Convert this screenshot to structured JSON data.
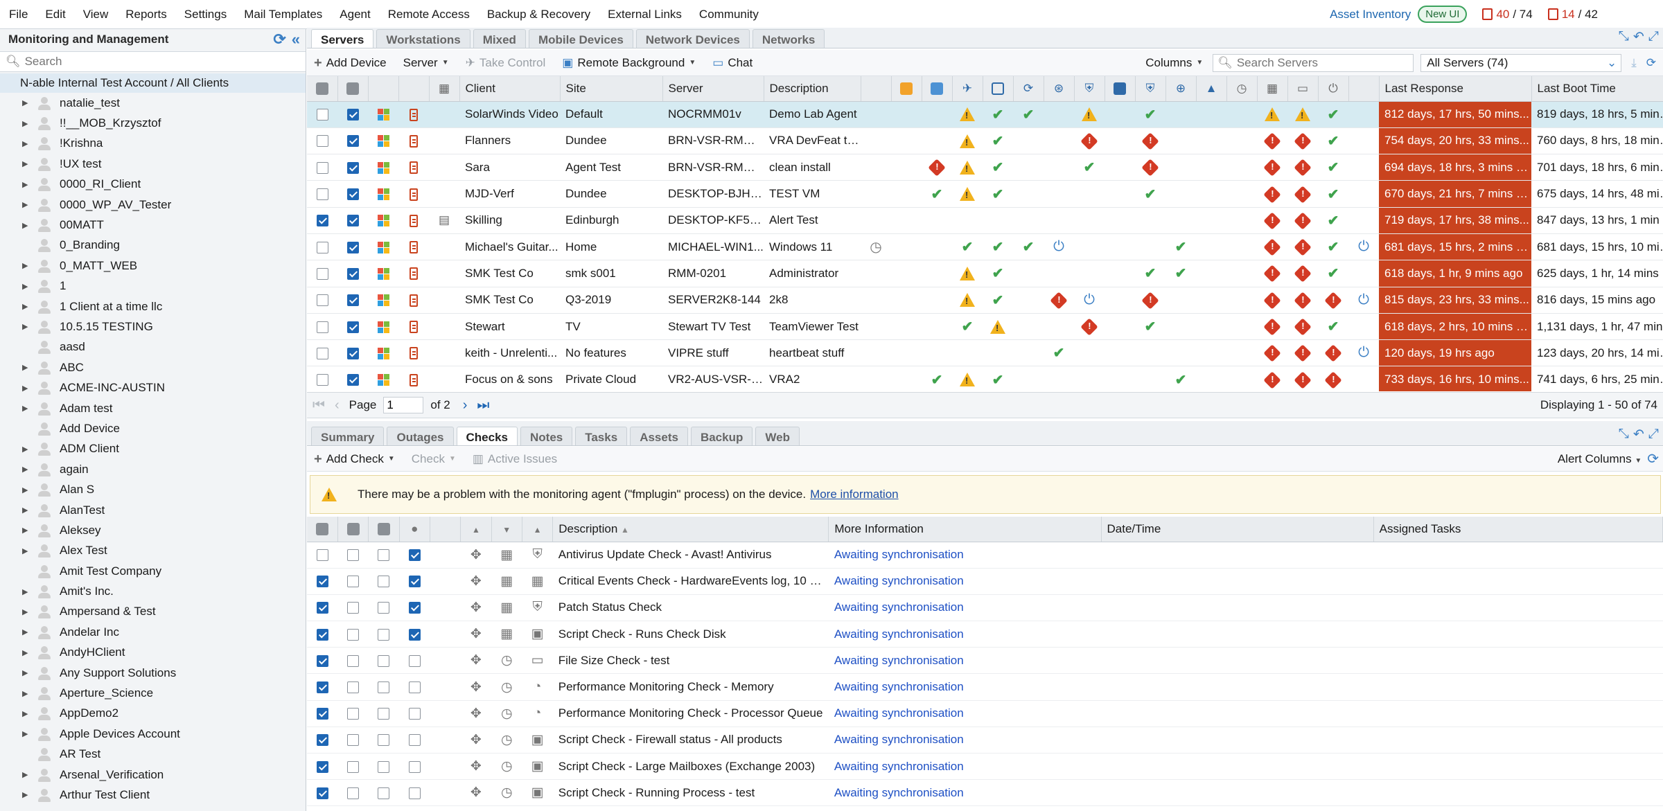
{
  "menu": {
    "items": [
      "File",
      "Edit",
      "View",
      "Reports",
      "Settings",
      "Mail Templates",
      "Agent",
      "Remote Access",
      "Backup & Recovery",
      "External Links",
      "Community"
    ],
    "asset_inventory": "Asset Inventory",
    "new_ui": "New UI",
    "counter1_value": "40",
    "counter1_total": "/ 74",
    "counter2_value": "14",
    "counter2_total": "/ 42"
  },
  "sidebar": {
    "title": "Monitoring and Management",
    "search_placeholder": "Search",
    "root": "N-able Internal Test Account / All Clients",
    "clients": [
      {
        "name": "natalie_test",
        "expandable": true
      },
      {
        "name": "!!__MOB_Krzysztof",
        "expandable": true
      },
      {
        "name": "!Krishna",
        "expandable": true
      },
      {
        "name": "!UX test",
        "expandable": true
      },
      {
        "name": "0000_RI_Client",
        "expandable": true
      },
      {
        "name": "0000_WP_AV_Tester",
        "expandable": true
      },
      {
        "name": "00MATT",
        "expandable": true
      },
      {
        "name": "0_Branding",
        "expandable": false
      },
      {
        "name": "0_MATT_WEB",
        "expandable": true
      },
      {
        "name": "1",
        "expandable": true
      },
      {
        "name": "1 Client at a time llc",
        "expandable": true
      },
      {
        "name": "10.5.15 TESTING",
        "expandable": true
      },
      {
        "name": "aasd",
        "expandable": false
      },
      {
        "name": "ABC",
        "expandable": true
      },
      {
        "name": "ACME-INC-AUSTIN",
        "expandable": true
      },
      {
        "name": "Adam test",
        "expandable": true
      },
      {
        "name": "Add Device",
        "expandable": false
      },
      {
        "name": "ADM Client",
        "expandable": true
      },
      {
        "name": "again",
        "expandable": true
      },
      {
        "name": "Alan S",
        "expandable": true
      },
      {
        "name": "AlanTest",
        "expandable": true
      },
      {
        "name": "Aleksey",
        "expandable": true
      },
      {
        "name": "Alex Test",
        "expandable": true
      },
      {
        "name": "Amit Test Company",
        "expandable": false
      },
      {
        "name": "Amit's Inc.",
        "expandable": true
      },
      {
        "name": "Ampersand & Test",
        "expandable": true
      },
      {
        "name": "Andelar Inc",
        "expandable": true
      },
      {
        "name": "AndyHClient",
        "expandable": true
      },
      {
        "name": "Any Support Solutions",
        "expandable": true
      },
      {
        "name": "Aperture_Science",
        "expandable": true
      },
      {
        "name": "AppDemo2",
        "expandable": true
      },
      {
        "name": "Apple Devices Account",
        "expandable": true
      },
      {
        "name": "AR Test",
        "expandable": false
      },
      {
        "name": "Arsenal_Verification",
        "expandable": true
      },
      {
        "name": "Arthur Test Client",
        "expandable": true
      }
    ]
  },
  "top_tabs": [
    "Servers",
    "Workstations",
    "Mixed",
    "Mobile Devices",
    "Network Devices",
    "Networks"
  ],
  "servers_toolbar": {
    "add_device": "Add Device",
    "server": "Server",
    "take_control": "Take Control",
    "remote_background": "Remote Background",
    "chat": "Chat",
    "columns": "Columns",
    "search_placeholder": "Search Servers",
    "filter": "All Servers (74)"
  },
  "servers_columns": {
    "client": "Client",
    "site": "Site",
    "server": "Server",
    "description": "Description",
    "last_response": "Last Response",
    "last_boot": "Last Boot Time"
  },
  "status_icon_colors": {
    "ok": "#3fa34d",
    "warn": "#f1b21d",
    "err": "#d33a24",
    "response_bg": "#c9431e"
  },
  "servers": [
    {
      "sel": false,
      "on": true,
      "note": false,
      "client": "SolarWinds Video",
      "site": "Default",
      "server": "NOCRMM01v",
      "desc": "Demo Lab Agent",
      "st": [
        "",
        "",
        "",
        "warn",
        "ok",
        "ok",
        "",
        "warn",
        "",
        "ok",
        "",
        "",
        "",
        "warn",
        "warn",
        "ok",
        ""
      ],
      "resp": "812 days, 17 hrs, 50 mins...",
      "boot": "819 days, 18 hrs, 5 mins a...",
      "highlight": true
    },
    {
      "sel": false,
      "on": true,
      "note": false,
      "client": "Flanners",
      "site": "Dundee",
      "server": "BRN-VSR-RMM-...",
      "desc": "VRA DevFeat te...",
      "st": [
        "",
        "",
        "",
        "warn",
        "ok",
        "",
        "",
        "err",
        "",
        "err",
        "",
        "",
        "",
        "err",
        "err",
        "ok",
        ""
      ],
      "resp": "754 days, 20 hrs, 33 mins...",
      "boot": "760 days, 8 hrs, 18 mins a..."
    },
    {
      "sel": false,
      "on": true,
      "note": false,
      "client": "Sara",
      "site": "Agent Test",
      "server": "BRN-VSR-RMM-...",
      "desc": "clean install",
      "st": [
        "",
        "",
        "err",
        "warn",
        "ok",
        "",
        "",
        "ok",
        "",
        "err",
        "",
        "",
        "",
        "err",
        "err",
        "ok",
        ""
      ],
      "resp": "694 days, 18 hrs, 3 mins a...",
      "boot": "701 days, 18 hrs, 6 mins a..."
    },
    {
      "sel": false,
      "on": true,
      "note": false,
      "client": "MJD-Verf",
      "site": "Dundee",
      "server": "DESKTOP-BJHR...",
      "desc": "TEST VM",
      "st": [
        "",
        "",
        "ok",
        "warn",
        "ok",
        "",
        "",
        "",
        "",
        "ok",
        "",
        "",
        "",
        "err",
        "err",
        "ok",
        ""
      ],
      "resp": "670 days, 21 hrs, 7 mins a...",
      "boot": "675 days, 14 hrs, 48 mins..."
    },
    {
      "sel": true,
      "on": true,
      "note": true,
      "client": "Skilling",
      "site": "Edinburgh",
      "server": "DESKTOP-KF5N...",
      "desc": "Alert Test",
      "st": [
        "",
        "",
        "",
        "",
        "",
        "",
        "",
        "",
        "",
        "",
        "",
        "",
        "",
        "err",
        "err",
        "ok",
        ""
      ],
      "resp": "719 days, 17 hrs, 38 mins...",
      "boot": "847 days, 13 hrs, 1 min ago"
    },
    {
      "sel": false,
      "on": true,
      "note": false,
      "client": "Michael's Guitar...",
      "site": "Home",
      "server": "MICHAEL-WIN1...",
      "desc": "Windows 11",
      "st": [
        "clock",
        "",
        "",
        "ok",
        "ok",
        "ok",
        "pow",
        "",
        "",
        "",
        "ok",
        "",
        "",
        "err",
        "err",
        "ok",
        "pow"
      ],
      "resp": "681 days, 15 hrs, 2 mins a...",
      "boot": "681 days, 15 hrs, 10 mins..."
    },
    {
      "sel": false,
      "on": true,
      "note": false,
      "client": "SMK Test Co",
      "site": "smk s001",
      "server": "RMM-0201",
      "desc": "Administrator",
      "st": [
        "",
        "",
        "",
        "warn",
        "ok",
        "",
        "",
        "",
        "",
        "ok",
        "ok",
        "",
        "",
        "err",
        "err",
        "ok",
        ""
      ],
      "resp": "618 days, 1 hr, 9 mins ago",
      "boot": "625 days, 1 hr, 14 mins ago"
    },
    {
      "sel": false,
      "on": true,
      "note": false,
      "client": "SMK Test Co",
      "site": "Q3-2019",
      "server": "SERVER2K8-144",
      "desc": "2k8",
      "st": [
        "",
        "",
        "",
        "warn",
        "ok",
        "",
        "err",
        "pow",
        "",
        "err",
        "",
        "",
        "",
        "err",
        "err",
        "err",
        "pow"
      ],
      "resp": "815 days, 23 hrs, 33 mins...",
      "boot": "816 days, 15 mins ago"
    },
    {
      "sel": false,
      "on": true,
      "note": false,
      "client": "Stewart",
      "site": "TV",
      "server": "Stewart TV Test",
      "desc": "TeamViewer Test",
      "st": [
        "",
        "",
        "",
        "ok",
        "warn",
        "",
        "",
        "err",
        "",
        "ok",
        "",
        "",
        "",
        "err",
        "err",
        "ok",
        ""
      ],
      "resp": "618 days, 2 hrs, 10 mins a...",
      "boot": "1,131 days, 1 hr, 47 mins ..."
    },
    {
      "sel": false,
      "on": true,
      "note": false,
      "client": "keith - Unrelenti...",
      "site": "No features",
      "server": "VIPRE stuff",
      "desc": "heartbeat stuff",
      "st": [
        "",
        "",
        "",
        "",
        "",
        "",
        "ok",
        "",
        "",
        "",
        "",
        "",
        "",
        "err",
        "err",
        "err",
        "pow"
      ],
      "resp": "120 days, 19 hrs ago",
      "boot": "123 days, 20 hrs, 14 mins..."
    },
    {
      "sel": false,
      "on": true,
      "note": false,
      "client": "Focus on & sons",
      "site": "Private Cloud",
      "server": "VR2-AUS-VSR-P...",
      "desc": "VRA2",
      "st": [
        "",
        "",
        "ok",
        "warn",
        "ok",
        "",
        "",
        "",
        "",
        "",
        "ok",
        "",
        "",
        "err",
        "err",
        "err",
        ""
      ],
      "resp": "733 days, 16 hrs, 10 mins...",
      "boot": "741 days, 6 hrs, 25 mins a..."
    }
  ],
  "pager": {
    "page_label": "Page",
    "page_value": "1",
    "of": "of 2",
    "displaying": "Displaying 1 - 50 of 74"
  },
  "bottom_tabs": [
    "Summary",
    "Outages",
    "Checks",
    "Notes",
    "Tasks",
    "Assets",
    "Backup",
    "Web"
  ],
  "checks_toolbar": {
    "add_check": "Add Check",
    "check": "Check",
    "active_issues": "Active Issues",
    "alert_columns": "Alert Columns"
  },
  "banner": {
    "text": "There may be a problem with the monitoring agent (\"fmplugin\" process) on the device.",
    "link": "More information"
  },
  "checks_columns": {
    "description": "Description",
    "more_info": "More Information",
    "datetime": "Date/Time",
    "assigned_tasks": "Assigned Tasks"
  },
  "checks": [
    {
      "c1": false,
      "c2": false,
      "c3": false,
      "c4": true,
      "type": "shield",
      "desc": "Antivirus Update Check - Avast! Antivirus",
      "info": "Awaiting synchronisation"
    },
    {
      "c1": true,
      "c2": false,
      "c3": false,
      "c4": true,
      "type": "calendar-x",
      "desc": "Critical Events Check - HardwareEvents log, 10 m...",
      "info": "Awaiting synchronisation"
    },
    {
      "c1": true,
      "c2": false,
      "c3": false,
      "c4": true,
      "type": "shield",
      "desc": "Patch Status Check",
      "info": "Awaiting synchronisation"
    },
    {
      "c1": true,
      "c2": false,
      "c3": false,
      "c4": true,
      "type": "script",
      "desc": "Script Check - Runs Check Disk",
      "info": "Awaiting synchronisation"
    },
    {
      "c1": true,
      "c2": false,
      "c3": false,
      "c4": false,
      "type": "disk",
      "desc": "File Size Check - test",
      "info": "Awaiting synchronisation"
    },
    {
      "c1": true,
      "c2": false,
      "c3": false,
      "c4": false,
      "type": "gauge",
      "desc": "Performance Monitoring Check - Memory",
      "info": "Awaiting synchronisation"
    },
    {
      "c1": true,
      "c2": false,
      "c3": false,
      "c4": false,
      "type": "gauge",
      "desc": "Performance Monitoring Check - Processor Queue",
      "info": "Awaiting synchronisation"
    },
    {
      "c1": true,
      "c2": false,
      "c3": false,
      "c4": false,
      "type": "script",
      "desc": "Script Check - Firewall status - All products",
      "info": "Awaiting synchronisation"
    },
    {
      "c1": true,
      "c2": false,
      "c3": false,
      "c4": false,
      "type": "script",
      "desc": "Script Check - Large Mailboxes (Exchange 2003)",
      "info": "Awaiting synchronisation"
    },
    {
      "c1": true,
      "c2": false,
      "c3": false,
      "c4": false,
      "type": "script",
      "desc": "Script Check - Running Process - test",
      "info": "Awaiting synchronisation"
    }
  ]
}
